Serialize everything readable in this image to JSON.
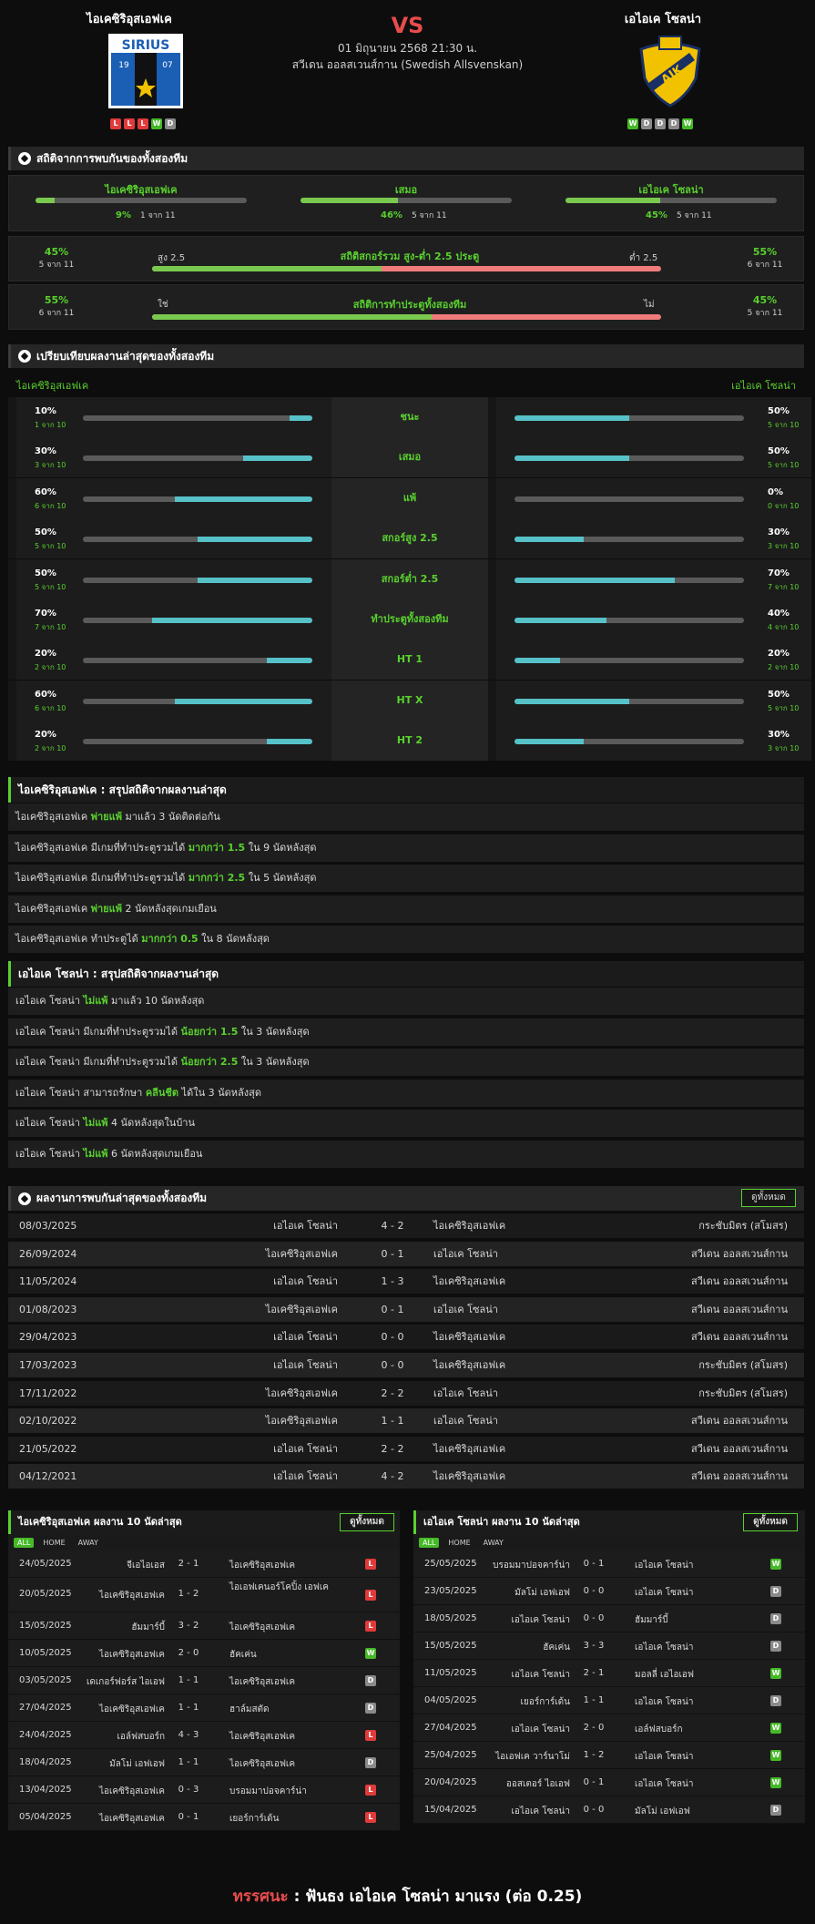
{
  "match": {
    "home": "ไอเคซิริอุสเอฟเค",
    "away": "เอไอเค โซลน่า",
    "vs": "VS",
    "date": "01 มิถุนายน 2568 21:30 น.",
    "league": "สวีเดน ออลสเวนส์กาน (Swedish Allsvenskan)",
    "home_form": [
      "L",
      "L",
      "L",
      "W",
      "D"
    ],
    "away_form": [
      "W",
      "D",
      "D",
      "D",
      "W"
    ],
    "home_logo_text": "SIRIUS",
    "home_logo_years": [
      "19",
      "07"
    ],
    "away_logo_text": "AIK"
  },
  "h2h_stats": {
    "title": "สถิติจากการพบกันของทั้งสองทีม",
    "cols": [
      {
        "label": "ไอเคซิริอุสเอฟเค",
        "pct": "9%",
        "count": "1 จาก 11",
        "fill": 0.09
      },
      {
        "label": "เสมอ",
        "pct": "46%",
        "count": "5 จาก 11",
        "fill": 0.46
      },
      {
        "label": "เอไอเค โซลน่า",
        "pct": "45%",
        "count": "5 จาก 11",
        "fill": 0.45
      }
    ],
    "ou": {
      "left_pct": "45%",
      "left_count": "5 จาก 11",
      "left_label": "สูง 2.5",
      "title": "สถิติสกอร์รวม สูง-ต่ำ 2.5 ประตู",
      "right_label": "ต่ำ 2.5",
      "right_pct": "55%",
      "right_count": "6 จาก 11",
      "fill": 0.45
    },
    "btts": {
      "left_pct": "55%",
      "left_count": "6 จาก 11",
      "left_label": "ใช่",
      "title": "สถิติการทำประตูทั้งสองทีม",
      "right_label": "ไม่",
      "right_pct": "45%",
      "right_count": "5 จาก 11",
      "fill": 0.55
    }
  },
  "compare": {
    "title": "เปรียบเทียบผลงานล่าสุดของทั้งสองทีม",
    "home": "ไอเคซิริอุสเอฟเค",
    "away": "เอไอเค โซลน่า",
    "rows": [
      {
        "label": "ชนะ",
        "hp": "10%",
        "hc": "1 จาก 10",
        "hf": 0.1,
        "ap": "50%",
        "ac": "5 จาก 10",
        "af": 0.5
      },
      {
        "label": "เสมอ",
        "hp": "30%",
        "hc": "3 จาก 10",
        "hf": 0.3,
        "ap": "50%",
        "ac": "5 จาก 10",
        "af": 0.5
      },
      {
        "label": "แพ้",
        "hp": "60%",
        "hc": "6 จาก 10",
        "hf": 0.6,
        "ap": "0%",
        "ac": "0 จาก 10",
        "af": 0.0
      },
      {
        "label": "สกอร์สูง 2.5",
        "hp": "50%",
        "hc": "5 จาก 10",
        "hf": 0.5,
        "ap": "30%",
        "ac": "3 จาก 10",
        "af": 0.3
      },
      {
        "label": "สกอร์ต่ำ 2.5",
        "hp": "50%",
        "hc": "5 จาก 10",
        "hf": 0.5,
        "ap": "70%",
        "ac": "7 จาก 10",
        "af": 0.7
      },
      {
        "label": "ทำประตูทั้งสองทีม",
        "hp": "70%",
        "hc": "7 จาก 10",
        "hf": 0.7,
        "ap": "40%",
        "ac": "4 จาก 10",
        "af": 0.4
      },
      {
        "label": "HT 1",
        "hp": "20%",
        "hc": "2 จาก 10",
        "hf": 0.2,
        "ap": "20%",
        "ac": "2 จาก 10",
        "af": 0.2
      },
      {
        "label": "HT X",
        "hp": "60%",
        "hc": "6 จาก 10",
        "hf": 0.6,
        "ap": "50%",
        "ac": "5 จาก 10",
        "af": 0.5
      },
      {
        "label": "HT 2",
        "hp": "20%",
        "hc": "2 จาก 10",
        "hf": 0.2,
        "ap": "30%",
        "ac": "3 จาก 10",
        "af": 0.3
      }
    ]
  },
  "home_summary": {
    "title": "ไอเคซิริอุสเอฟเค : สรุปสถิติจากผลงานล่าสุด",
    "rows": [
      [
        "ไอเคซิริอุสเอฟเค ",
        "พ่ายแพ้",
        " มาแล้ว 3 นัดติดต่อกัน"
      ],
      [
        "ไอเคซิริอุสเอฟเค มีเกมที่ทำประตูรวมได้ ",
        "มากกว่า 1.5",
        " ใน 9 นัดหลังสุด"
      ],
      [
        "ไอเคซิริอุสเอฟเค มีเกมที่ทำประตูรวมได้ ",
        "มากกว่า 2.5",
        " ใน 5 นัดหลังสุด"
      ],
      [
        "ไอเคซิริอุสเอฟเค ",
        "พ่ายแพ้",
        " 2 นัดหลังสุดเกมเยือน"
      ],
      [
        "ไอเคซิริอุสเอฟเค ทำประตูได้ ",
        "มากกว่า 0.5",
        " ใน 8 นัดหลังสุด"
      ]
    ]
  },
  "away_summary": {
    "title": "เอไอเค โซลน่า : สรุปสถิติจากผลงานล่าสุด",
    "rows": [
      [
        "เอไอเค โซลน่า ",
        "ไม่แพ้",
        " มาแล้ว 10 นัดหลังสุด"
      ],
      [
        "เอไอเค โซลน่า มีเกมที่ทำประตูรวมได้ ",
        "น้อยกว่า 1.5",
        " ใน 3 นัดหลังสุด"
      ],
      [
        "เอไอเค โซลน่า มีเกมที่ทำประตูรวมได้ ",
        "น้อยกว่า 2.5",
        " ใน 3 นัดหลังสุด"
      ],
      [
        "เอไอเค โซลน่า สามารถรักษา ",
        "คลีนชีต",
        " ได้ใน 3 นัดหลังสุด"
      ],
      [
        "เอไอเค โซลน่า ",
        "ไม่แพ้",
        " 4 นัดหลังสุดในบ้าน"
      ],
      [
        "เอไอเค โซลน่า ",
        "ไม่แพ้",
        " 6 นัดหลังสุดเกมเยือน"
      ]
    ]
  },
  "h2h_list": {
    "title": "ผลงานการพบกันล่าสุดของทั้งสองทีม",
    "view_all": "ดูทั้งหมด",
    "rows": [
      [
        "08/03/2025",
        "เอไอเค โซลน่า",
        "4 - 2",
        "ไอเคซิริอุสเอฟเค",
        "กระชับมิตร (สโมสร)"
      ],
      [
        "26/09/2024",
        "ไอเคซิริอุสเอฟเค",
        "0 - 1",
        "เอไอเค โซลน่า",
        "สวีเดน ออลสเวนส์กาน"
      ],
      [
        "11/05/2024",
        "เอไอเค โซลน่า",
        "1 - 3",
        "ไอเคซิริอุสเอฟเค",
        "สวีเดน ออลสเวนส์กาน"
      ],
      [
        "01/08/2023",
        "ไอเคซิริอุสเอฟเค",
        "0 - 1",
        "เอไอเค โซลน่า",
        "สวีเดน ออลสเวนส์กาน"
      ],
      [
        "29/04/2023",
        "เอไอเค โซลน่า",
        "0 - 0",
        "ไอเคซิริอุสเอฟเค",
        "สวีเดน ออลสเวนส์กาน"
      ],
      [
        "17/03/2023",
        "เอไอเค โซลน่า",
        "0 - 0",
        "ไอเคซิริอุสเอฟเค",
        "กระชับมิตร (สโมสร)"
      ],
      [
        "17/11/2022",
        "ไอเคซิริอุสเอฟเค",
        "2 - 2",
        "เอไอเค โซลน่า",
        "กระชับมิตร (สโมสร)"
      ],
      [
        "02/10/2022",
        "ไอเคซิริอุสเอฟเค",
        "1 - 1",
        "เอไอเค โซลน่า",
        "สวีเดน ออลสเวนส์กาน"
      ],
      [
        "21/05/2022",
        "เอไอเค โซลน่า",
        "2 - 2",
        "ไอเคซิริอุสเอฟเค",
        "สวีเดน ออลสเวนส์กาน"
      ],
      [
        "04/12/2021",
        "เอไอเค โซลน่า",
        "4 - 2",
        "ไอเคซิริอุสเอฟเค",
        "สวีเดน ออลสเวนส์กาน"
      ]
    ]
  },
  "home_last10": {
    "title": "ไอเคซิริอุสเอฟเค ผลงาน 10 นัดล่าสุด",
    "view_all": "ดูทั้งหมด",
    "tabs": [
      "ALL",
      "HOME",
      "AWAY"
    ],
    "rows": [
      [
        "24/05/2025",
        "จีเอไอเอส",
        "2 - 1",
        "ไอเคซิริอุสเอฟเค",
        "L"
      ],
      [
        "20/05/2025",
        "ไอเคซิริอุสเอฟเค",
        "1 - 2",
        "ไอเอฟเคนอร์โคปิ้ง เอฟเค",
        "L"
      ],
      [
        "15/05/2025",
        "ฮัมมาร์บี้",
        "3 - 2",
        "ไอเคซิริอุสเอฟเค",
        "L"
      ],
      [
        "10/05/2025",
        "ไอเคซิริอุสเอฟเค",
        "2 - 0",
        "ฮัคเค่น",
        "W"
      ],
      [
        "03/05/2025",
        "เดเกอร์ฟอร์ส ไอเอฟ",
        "1 - 1",
        "ไอเคซิริอุสเอฟเค",
        "D"
      ],
      [
        "27/04/2025",
        "ไอเคซิริอุสเอฟเค",
        "1 - 1",
        "ฮาล์มสตัด",
        "D"
      ],
      [
        "24/04/2025",
        "เอล์ฟสบอร์ก",
        "4 - 3",
        "ไอเคซิริอุสเอฟเค",
        "L"
      ],
      [
        "18/04/2025",
        "มัลโม่ เอฟเอฟ",
        "1 - 1",
        "ไอเคซิริอุสเอฟเค",
        "D"
      ],
      [
        "13/04/2025",
        "ไอเคซิริอุสเอฟเค",
        "0 - 3",
        "บรอมมาปอจคาร์น่า",
        "L"
      ],
      [
        "05/04/2025",
        "ไอเคซิริอุสเอฟเค",
        "0 - 1",
        "เยอร์การ์เด้น",
        "L"
      ]
    ]
  },
  "away_last10": {
    "title": "เอไอเค โซลน่า ผลงาน 10 นัดล่าสุด",
    "view_all": "ดูทั้งหมด",
    "tabs": [
      "ALL",
      "HOME",
      "AWAY"
    ],
    "rows": [
      [
        "25/05/2025",
        "บรอมมาปอจคาร์น่า",
        "0 - 1",
        "เอไอเค โซลน่า",
        "W"
      ],
      [
        "23/05/2025",
        "มัลโม่ เอฟเอฟ",
        "0 - 0",
        "เอไอเค โซลน่า",
        "D"
      ],
      [
        "18/05/2025",
        "เอไอเค โซลน่า",
        "0 - 0",
        "ฮัมมาร์บี้",
        "D"
      ],
      [
        "15/05/2025",
        "ฮัคเค่น",
        "3 - 3",
        "เอไอเค โซลน่า",
        "D"
      ],
      [
        "11/05/2025",
        "เอไอเค โซลน่า",
        "2 - 1",
        "มอลลี่ เอไอเอฟ",
        "W"
      ],
      [
        "04/05/2025",
        "เยอร์การ์เด้น",
        "1 - 1",
        "เอไอเค โซลน่า",
        "D"
      ],
      [
        "27/04/2025",
        "เอไอเค โซลน่า",
        "2 - 0",
        "เอล์ฟสบอร์ก",
        "W"
      ],
      [
        "25/04/2025",
        "ไอเอฟเค วาร์นาโม่",
        "1 - 2",
        "เอไอเค โซลน่า",
        "W"
      ],
      [
        "20/04/2025",
        "ออสเตอร์ ไอเอฟ",
        "0 - 1",
        "เอไอเค โซลน่า",
        "W"
      ],
      [
        "15/04/2025",
        "เอไอเค โซลน่า",
        "0 - 0",
        "มัลโม่ เอฟเอฟ",
        "D"
      ]
    ]
  },
  "verdict": {
    "label": "ทรรศนะ",
    "sep": " : ",
    "text": "ฟันธง เอไอเค โซลน่า มาแรง (ต่อ 0.25)"
  },
  "colors": {
    "accent": "#59d12e",
    "red": "#e84c4c",
    "teal": "#57c1c8",
    "grey_bar": "#5a5a5a"
  }
}
